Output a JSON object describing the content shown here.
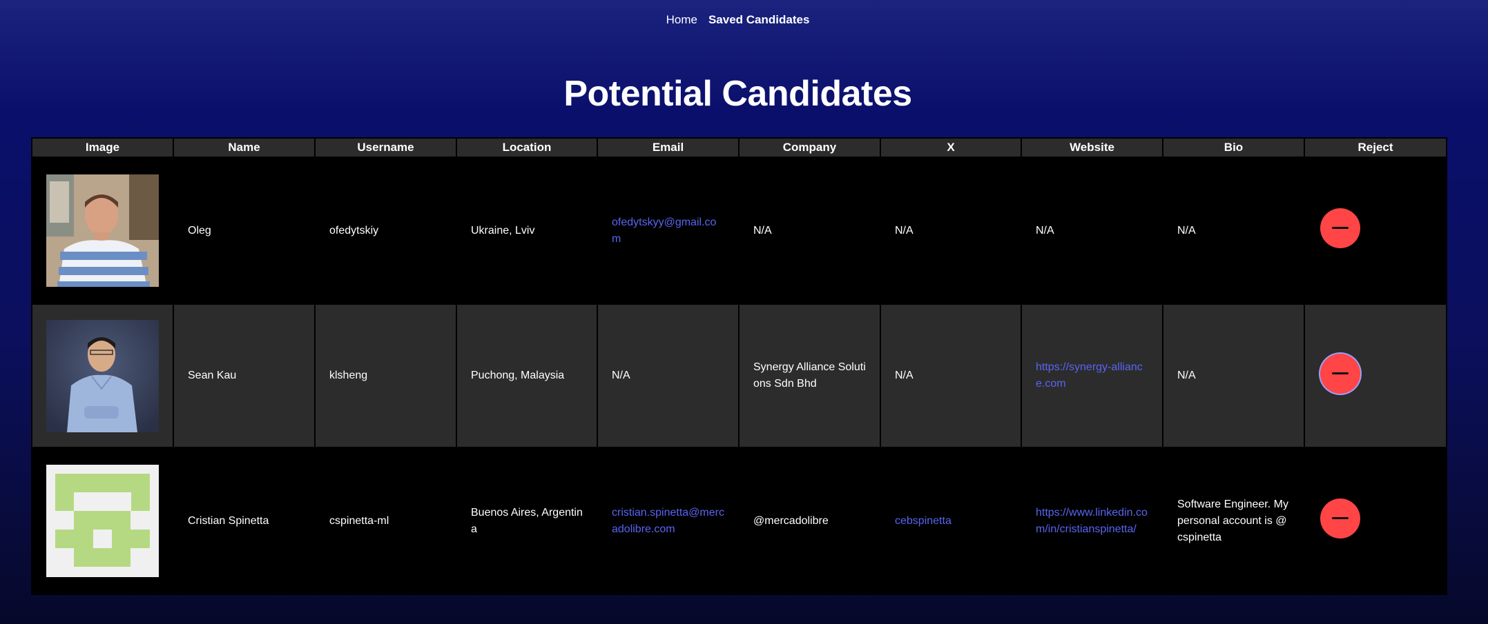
{
  "nav": {
    "home": "Home",
    "saved": "Saved Candidates"
  },
  "page_title": "Potential Candidates",
  "columns": [
    "Image",
    "Name",
    "Username",
    "Location",
    "Email",
    "Company",
    "X",
    "Website",
    "Bio",
    "Reject"
  ],
  "candidates": [
    {
      "name": "Oleg",
      "username": "ofedytskiy",
      "location": "Ukraine, Lviv",
      "email": "ofedytskyy@gmail.com",
      "company": "N/A",
      "x": "N/A",
      "website": "N/A",
      "bio": "N/A"
    },
    {
      "name": "Sean Kau",
      "username": "klsheng",
      "location": "Puchong, Malaysia",
      "email": "N/A",
      "company": "Synergy Alliance Solutions Sdn Bhd",
      "x": "N/A",
      "website": "https://synergy-alliance.com",
      "bio": "N/A"
    },
    {
      "name": "Cristian Spinetta",
      "username": "cspinetta-ml",
      "location": "Buenos Aires, Argentina",
      "email": "cristian.spinetta@mercadolibre.com",
      "company": "@mercadolibre",
      "x": "cebspinetta",
      "website": "https://www.linkedin.com/in/cristianspinetta/",
      "bio": "Software Engineer. My personal account is @cspinetta"
    }
  ],
  "colors": {
    "accent_link": "#5865f2",
    "reject_button": "#ff4545",
    "header_cell": "#2c2c2c"
  }
}
